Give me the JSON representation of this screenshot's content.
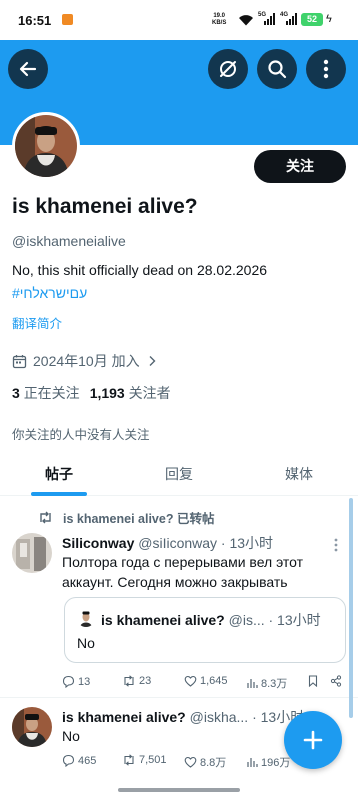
{
  "status_bar": {
    "time": "16:51",
    "speed_value": "19.0",
    "speed_unit": "KB/S",
    "net1": "5G",
    "net2": "4G",
    "battery": "52"
  },
  "colors": {
    "brand_blue": "#1d9bf0",
    "text_primary": "#0f1419",
    "text_secondary": "#536471"
  },
  "header": {
    "back_icon": "arrow-left-icon",
    "premium_icon": "slashed-circle-icon",
    "search_icon": "search-icon",
    "more_icon": "more-vertical-icon"
  },
  "profile": {
    "follow_label": "关注",
    "name": "is khamenei alive?",
    "handle": "@iskhameneialive",
    "bio": "No, this shit officially dead on 28.02.2026",
    "hashtag": "#עםישראלחי",
    "translate_label": "翻译简介",
    "joined": "2024年10月 加入",
    "following_count": "3",
    "following_label": "正在关注",
    "followers_count": "1,193",
    "followers_label": "关注者",
    "mutual_text": "你关注的人中没有人关注"
  },
  "tabs": [
    {
      "label": "帖子"
    },
    {
      "label": "回复"
    },
    {
      "label": "媒体"
    }
  ],
  "posts": [
    {
      "repost_label": "is khamenei alive? 已转帖",
      "name": "Siliconway",
      "meta": "@siIiconway · 13小时",
      "text_line1": "Полтора года с перерывами вел этот",
      "text_line2": "аккаунт. Сегодня можно закрывать",
      "quote": {
        "name": "is khamenei alive?",
        "meta": "@is... · 13小时",
        "text": "No"
      },
      "actions": {
        "replies": "13",
        "reposts": "23",
        "likes": "1,645",
        "views": "8.3万"
      }
    },
    {
      "name": "is khamenei alive?",
      "meta": "@iskha... · 13小时",
      "text": "No",
      "actions": {
        "replies": "465",
        "reposts": "7,501",
        "likes": "8.8万",
        "views": "196万"
      }
    }
  ]
}
